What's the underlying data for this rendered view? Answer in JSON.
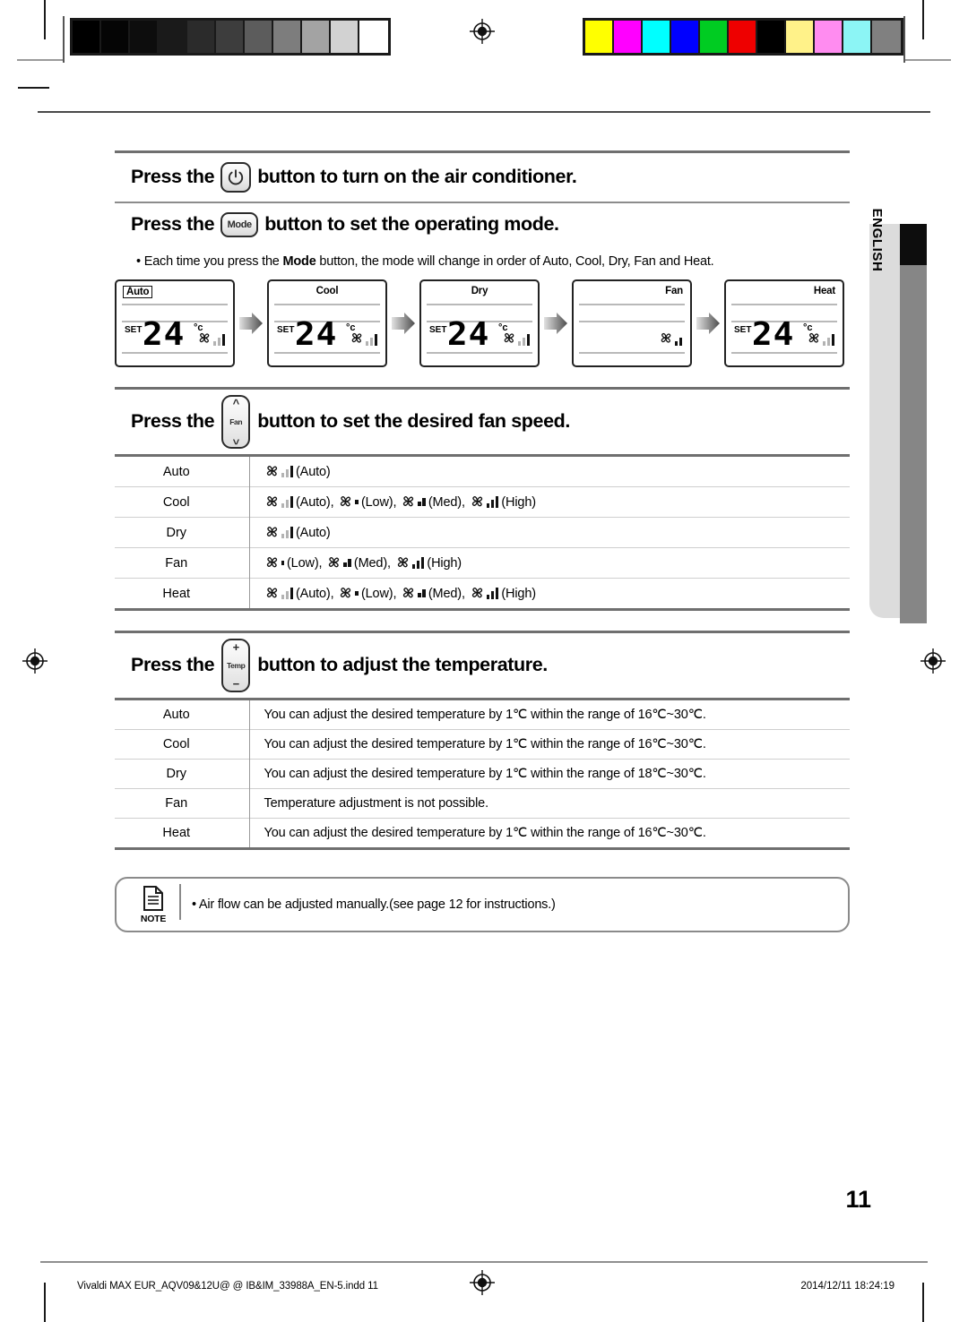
{
  "print_marks": {
    "grayscale_patches": [
      "#000000",
      "#050505",
      "#0d0d0d",
      "#1a1a1a",
      "#2b2b2b",
      "#3d3d3d",
      "#5c5c5c",
      "#7d7d7d",
      "#a3a3a3",
      "#d2d2d2",
      "#ffffff"
    ],
    "color_patches": [
      "#ffff00",
      "#ff00ff",
      "#00ffff",
      "#0000ff",
      "#00cc22",
      "#ee0000",
      "#000000",
      "#fff289",
      "#ff8cf0",
      "#8cf5f5",
      "#808080"
    ],
    "registration_icon": "registration-target-icon"
  },
  "side_tab": {
    "label": "ENGLISH"
  },
  "sections": [
    {
      "id": "power",
      "prefix": "Press the",
      "button": {
        "name": "power-button",
        "glyph": "power-icon",
        "label": ""
      },
      "suffix": "button to turn on the air conditioner."
    },
    {
      "id": "mode",
      "prefix": "Press the",
      "button": {
        "name": "mode-button",
        "glyph": "mode-label",
        "label": "Mode"
      },
      "suffix": "button to set the operating mode.",
      "bullet_prefix": "Each time you press the ",
      "bullet_bold": "Mode",
      "bullet_suffix": " button, the mode will change in order of Auto, Cool, Dry, Fan and Heat."
    },
    {
      "id": "fan",
      "prefix": "Press the",
      "button": {
        "name": "fan-rocker-button",
        "glyph": "up-down-chevrons",
        "label": "Fan"
      },
      "suffix": "button to set the desired fan speed."
    },
    {
      "id": "temp",
      "prefix": "Press the",
      "button": {
        "name": "temp-rocker-button",
        "glyph": "plus-minus",
        "label": "Temp"
      },
      "suffix": "button to adjust the temperature."
    }
  ],
  "lcd_panels": [
    {
      "mode": "Auto",
      "align": "left",
      "boxed": true,
      "set": "SET",
      "temp": "24",
      "unit": "°c",
      "show_temp": true,
      "fan_bars": "auto"
    },
    {
      "mode": "Cool",
      "align": "center",
      "boxed": false,
      "set": "SET",
      "temp": "24",
      "unit": "°c",
      "show_temp": true,
      "fan_bars": "auto"
    },
    {
      "mode": "Dry",
      "align": "center",
      "boxed": false,
      "set": "SET",
      "temp": "24",
      "unit": "°c",
      "show_temp": true,
      "fan_bars": "auto"
    },
    {
      "mode": "Fan",
      "align": "right",
      "boxed": false,
      "set": "",
      "temp": "",
      "unit": "",
      "show_temp": false,
      "fan_bars": "med"
    },
    {
      "mode": "Heat",
      "align": "right",
      "boxed": false,
      "set": "SET",
      "temp": "24",
      "unit": "°c",
      "show_temp": true,
      "fan_bars": "auto"
    }
  ],
  "fan_speed_table": {
    "rows": [
      {
        "mode": "Auto",
        "options": [
          {
            "bars": "auto",
            "caption": "(Auto)"
          }
        ]
      },
      {
        "mode": "Cool",
        "options": [
          {
            "bars": "auto",
            "caption": "(Auto),"
          },
          {
            "bars": "low",
            "caption": "(Low),"
          },
          {
            "bars": "med",
            "caption": "(Med),"
          },
          {
            "bars": "high",
            "caption": "(High)"
          }
        ]
      },
      {
        "mode": "Dry",
        "options": [
          {
            "bars": "auto",
            "caption": "(Auto)"
          }
        ]
      },
      {
        "mode": "Fan",
        "options": [
          {
            "bars": "low",
            "caption": "(Low),"
          },
          {
            "bars": "med",
            "caption": "(Med),"
          },
          {
            "bars": "high",
            "caption": "(High)"
          }
        ]
      },
      {
        "mode": "Heat",
        "options": [
          {
            "bars": "auto",
            "caption": "(Auto),"
          },
          {
            "bars": "low",
            "caption": "(Low),"
          },
          {
            "bars": "med",
            "caption": "(Med),"
          },
          {
            "bars": "high",
            "caption": "(High)"
          }
        ]
      }
    ]
  },
  "temperature_table": {
    "rows": [
      {
        "mode": "Auto",
        "text": "You can adjust the desired temperature by 1℃ within the range of 16℃~30℃."
      },
      {
        "mode": "Cool",
        "text": "You can adjust the desired temperature by 1℃ within the range of 16℃~30℃."
      },
      {
        "mode": "Dry",
        "text": "You can adjust the desired temperature by 1℃ within the range of 18℃~30℃."
      },
      {
        "mode": "Fan",
        "text": "Temperature adjustment is not possible."
      },
      {
        "mode": "Heat",
        "text": "You can adjust the desired temperature by 1℃ within the range of 16℃~30℃."
      }
    ]
  },
  "note": {
    "label": "NOTE",
    "icon": "document-note-icon",
    "text": "•  Air flow can be adjusted manually.(see page 12 for instructions.)"
  },
  "page_number": "11",
  "footer": {
    "left": "Vivaldi MAX EUR_AQV09&12U@ @  IB&IM_33988A_EN-5.indd   11",
    "right": "2014/12/11   18:24:19"
  }
}
